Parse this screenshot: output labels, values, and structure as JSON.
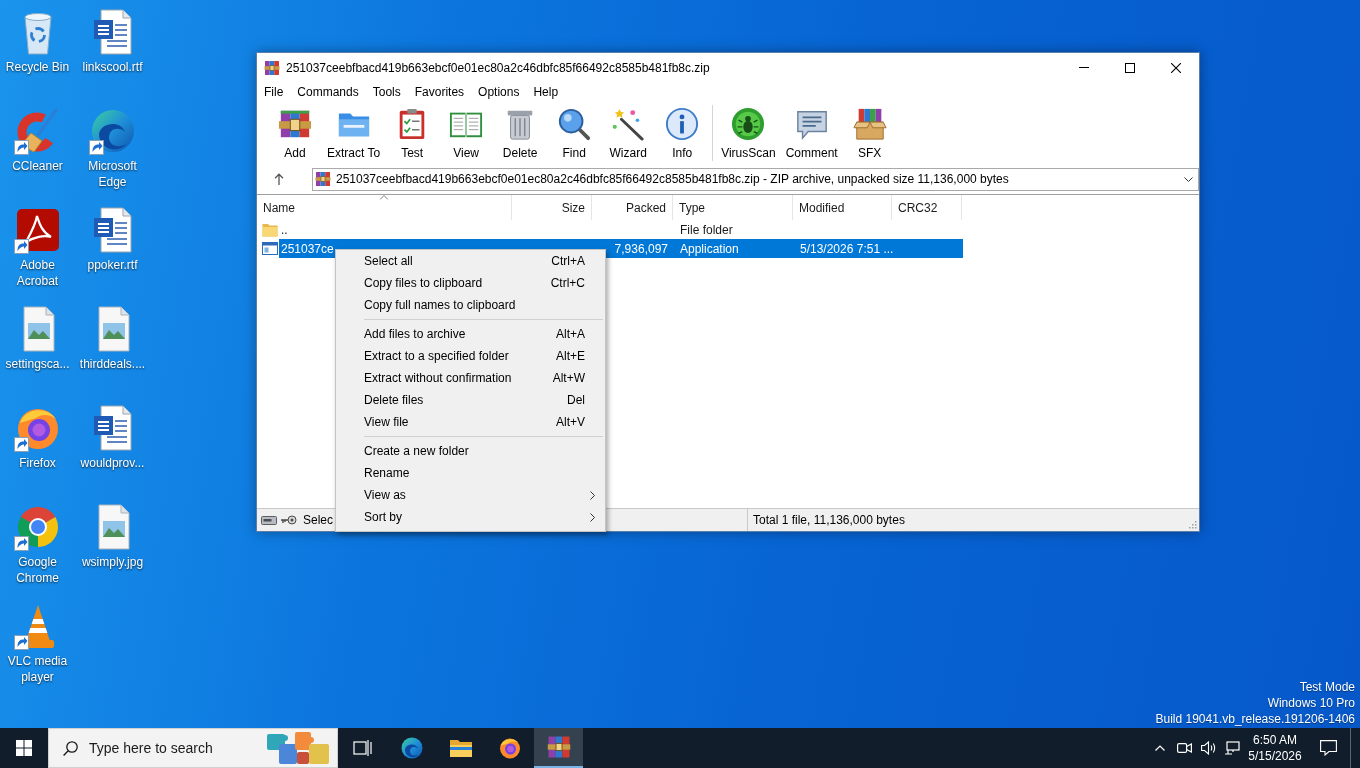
{
  "desktop_icons": [
    {
      "label": "Recycle Bin",
      "kind": "recyclebin",
      "shortcut": false
    },
    {
      "label": "linkscool.rtf",
      "kind": "word",
      "shortcut": false
    },
    {
      "label": "CCleaner",
      "kind": "ccleaner",
      "shortcut": true
    },
    {
      "label": "Microsoft Edge",
      "kind": "edge",
      "shortcut": true
    },
    {
      "label": "Adobe Acrobat",
      "kind": "acrobat",
      "shortcut": true
    },
    {
      "label": "ppoker.rtf",
      "kind": "word",
      "shortcut": false
    },
    {
      "label": "settingsca...",
      "kind": "image",
      "shortcut": false
    },
    {
      "label": "thirddeals....",
      "kind": "image",
      "shortcut": false
    },
    {
      "label": "Firefox",
      "kind": "firefox",
      "shortcut": true
    },
    {
      "label": "wouldprov...",
      "kind": "word",
      "shortcut": false
    },
    {
      "label": "Google Chrome",
      "kind": "chrome",
      "shortcut": true
    },
    {
      "label": "wsimply.jpg",
      "kind": "image",
      "shortcut": false
    },
    {
      "label": "VLC media player",
      "kind": "vlc",
      "shortcut": true
    }
  ],
  "os_build_info": [
    "Test Mode",
    "Windows 10 Pro",
    "Build 19041.vb_release.191206-1406"
  ],
  "window": {
    "title": "251037ceebfbacd419b663ebcf0e01ec80a2c46dbfc85f66492c8585b481fb8c.zip",
    "menu": [
      "File",
      "Commands",
      "Tools",
      "Favorites",
      "Options",
      "Help"
    ],
    "toolbar_groups": [
      [
        {
          "label": "Add",
          "kind": "add"
        },
        {
          "label": "Extract To",
          "kind": "extract"
        },
        {
          "label": "Test",
          "kind": "test"
        },
        {
          "label": "View",
          "kind": "view"
        },
        {
          "label": "Delete",
          "kind": "delete"
        },
        {
          "label": "Find",
          "kind": "find"
        },
        {
          "label": "Wizard",
          "kind": "wizard"
        },
        {
          "label": "Info",
          "kind": "info"
        }
      ],
      [
        {
          "label": "VirusScan",
          "kind": "virusscan"
        },
        {
          "label": "Comment",
          "kind": "comment"
        },
        {
          "label": "SFX",
          "kind": "sfx"
        }
      ]
    ],
    "address": "251037ceebfbacd419b663ebcf0e01ec80a2c46dbfc85f66492c8585b481fb8c.zip - ZIP archive, unpacked size 11,136,000 bytes",
    "file_list": {
      "columns": [
        {
          "label": "Name",
          "sorted": true
        },
        {
          "label": "Size",
          "sorted": false
        },
        {
          "label": "Packed",
          "sorted": false
        },
        {
          "label": "Type",
          "sorted": false
        },
        {
          "label": "Modified",
          "sorted": false
        },
        {
          "label": "CRC32",
          "sorted": false
        }
      ],
      "rows": [
        {
          "kind": "folder",
          "name": "..",
          "type": "File folder",
          "selected": false
        },
        {
          "kind": "application",
          "name": "251037ce",
          "packed": "7,936,097",
          "type": "Application",
          "modified": "5/13/2026 7:51 ...",
          "selected": true
        }
      ]
    },
    "status_bar": {
      "selection": "Selec",
      "total": "Total 1 file, 11,136,000 bytes"
    }
  },
  "context_menu": {
    "groups": [
      [
        {
          "label": "Select all",
          "shortcut": "Ctrl+A",
          "submenu": false
        },
        {
          "label": "Copy files to clipboard",
          "shortcut": "Ctrl+C",
          "submenu": false
        },
        {
          "label": "Copy full names to clipboard",
          "submenu": false
        }
      ],
      [
        {
          "label": "Add files to archive",
          "shortcut": "Alt+A",
          "submenu": false
        },
        {
          "label": "Extract to a specified folder",
          "shortcut": "Alt+E",
          "submenu": false
        },
        {
          "label": "Extract without confirmation",
          "shortcut": "Alt+W",
          "submenu": false
        },
        {
          "label": "Delete files",
          "shortcut": "Del",
          "submenu": false
        },
        {
          "label": "View file",
          "shortcut": "Alt+V",
          "submenu": false
        }
      ],
      [
        {
          "label": "Create a new folder",
          "submenu": false
        },
        {
          "label": "Rename",
          "submenu": false
        },
        {
          "label": "View as",
          "submenu": true
        },
        {
          "label": "Sort by",
          "submenu": true
        }
      ]
    ]
  },
  "taskbar": {
    "search_placeholder": "Type here to search",
    "apps": [
      {
        "kind": "taskview",
        "active": false
      },
      {
        "kind": "edge",
        "active": false
      },
      {
        "kind": "explorer",
        "active": false
      },
      {
        "kind": "firefox",
        "active": false
      },
      {
        "kind": "winrar",
        "active": true
      }
    ],
    "clock": {
      "time": "6:50 AM",
      "date": "5/15/2026"
    }
  }
}
